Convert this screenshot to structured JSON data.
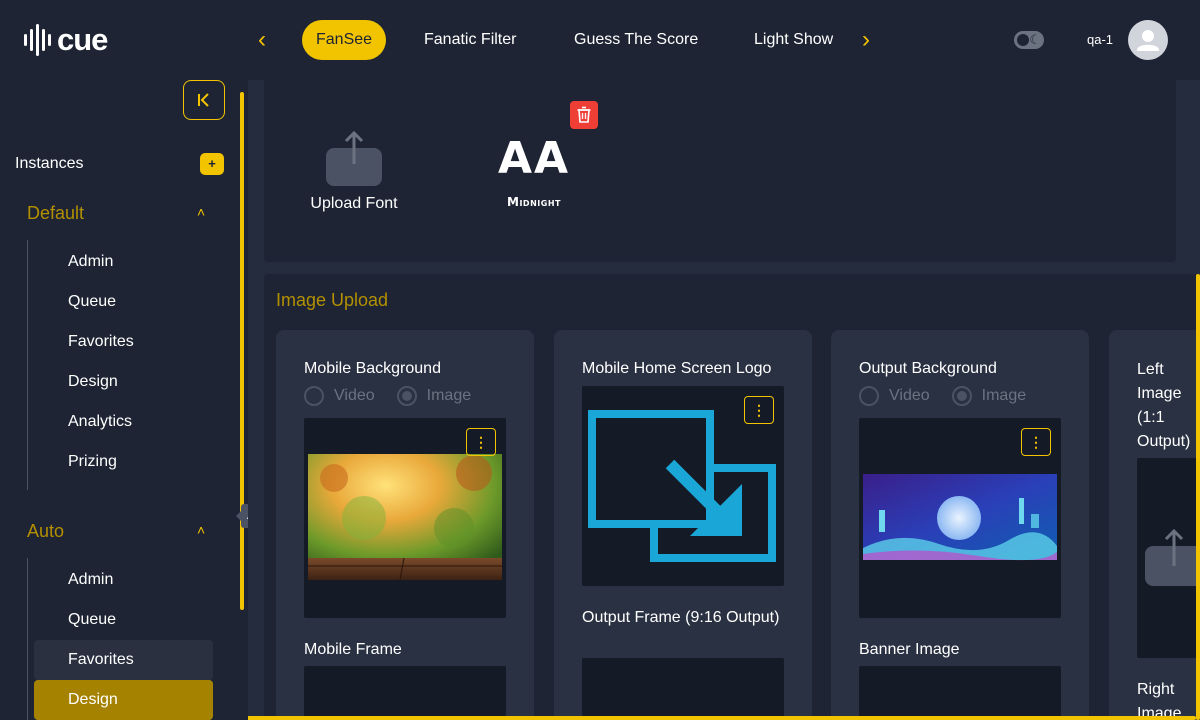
{
  "app": {
    "logo_text": "cue"
  },
  "nav": {
    "prev_icon": "chevron-left",
    "next_icon": "chevron-right",
    "tabs": [
      {
        "label": "FanSee",
        "active": true
      },
      {
        "label": "Fanatic Filter",
        "active": false
      },
      {
        "label": "Guess The Score",
        "active": false
      },
      {
        "label": "Light Show",
        "active": false
      }
    ]
  },
  "user": {
    "name": "qa-1",
    "theme_icon": "moon-icon"
  },
  "sidebar": {
    "collapse_icon": "collapse-left",
    "instances_label": "Instances",
    "add_label": "+",
    "groups": [
      {
        "label": "Default",
        "expanded": true,
        "items": [
          "Admin",
          "Queue",
          "Favorites",
          "Design",
          "Analytics",
          "Prizing"
        ]
      },
      {
        "label": "Auto",
        "expanded": true,
        "items": [
          "Admin",
          "Queue",
          "Favorites",
          "Design"
        ]
      }
    ],
    "tooltip": "Auto"
  },
  "fonts": {
    "upload_label": "Upload Font",
    "preview_glyph": "AA",
    "font_name": "Midnight"
  },
  "image_upload": {
    "title": "Image Upload",
    "cards": [
      {
        "title": "Mobile Background",
        "radio": {
          "video": "Video",
          "image": "Image",
          "selected": "Image"
        },
        "second_label": "Mobile Frame"
      },
      {
        "title": "Mobile Home Screen Logo",
        "second_label": "Output Frame (9:16 Output)"
      },
      {
        "title": "Output Background",
        "radio": {
          "video": "Video",
          "image": "Image",
          "selected": "Image"
        },
        "second_label": "Banner Image"
      },
      {
        "title": "Left Image (1:1 Output)",
        "second_label": "Right Image"
      }
    ]
  },
  "colors": {
    "accent": "#f2c400",
    "background": "#1e2433",
    "panel": "#2a3142",
    "danger": "#ef3e36",
    "logo_blue": "#1aa7d8"
  }
}
